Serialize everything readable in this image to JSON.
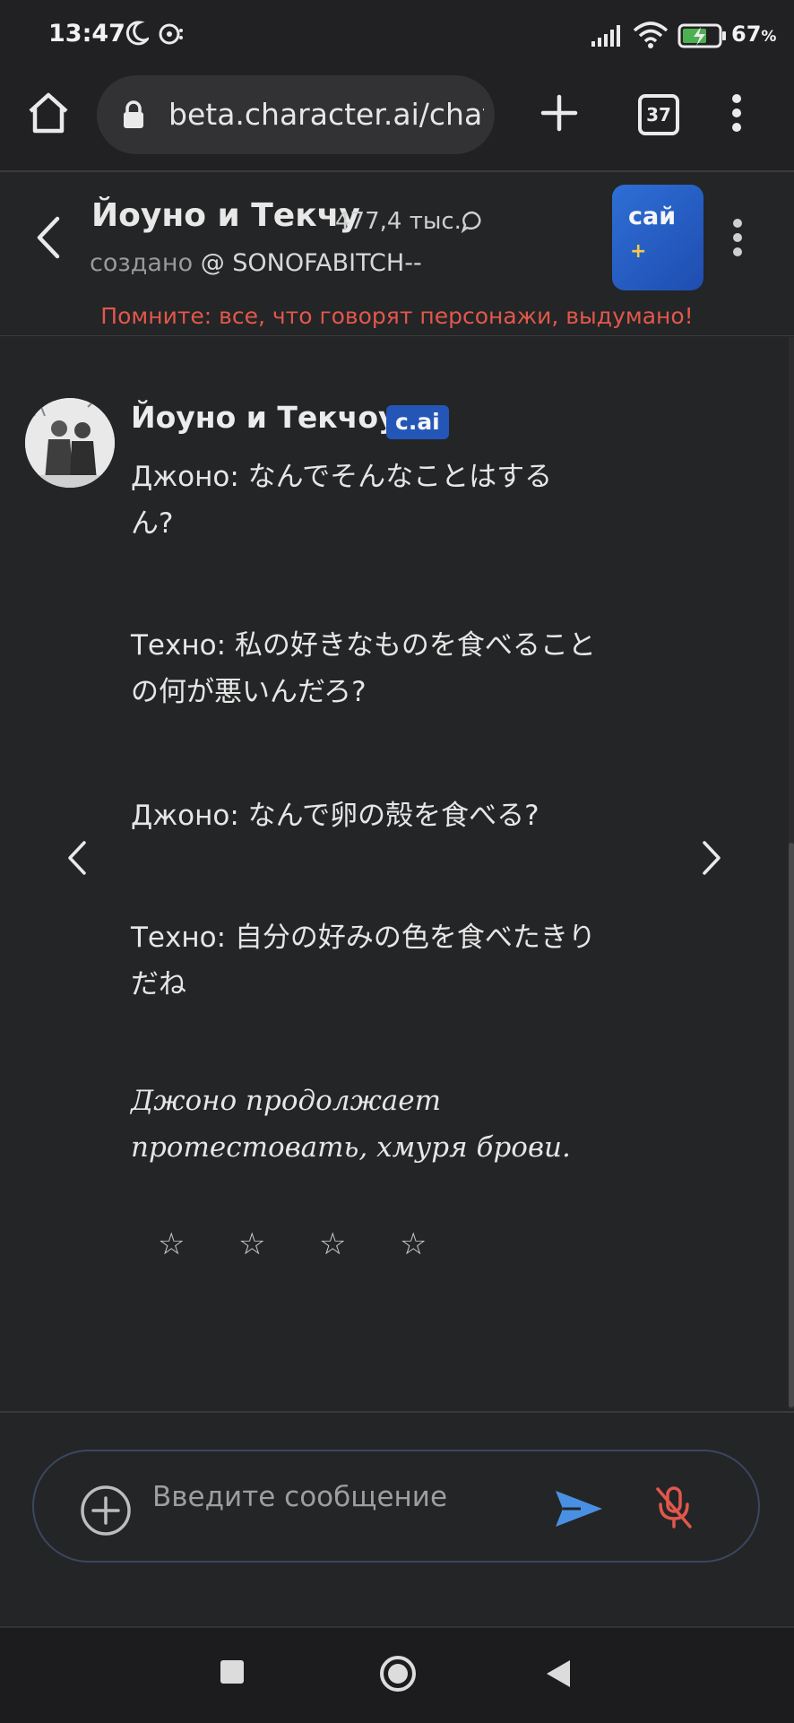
{
  "status_bar": {
    "time": "13:47",
    "battery_percent": "67",
    "battery_unit": "%"
  },
  "browser": {
    "url": "beta.character.ai/chat",
    "tab_count": "37"
  },
  "chat_header": {
    "character_name": "Йоуно и Текчу",
    "chat_count": "477,4 тыс.",
    "creator_prefix": "создано",
    "creator_handle": "@ SONOFABITCH--",
    "plus_label": "сай",
    "plus_mark": "+",
    "warning": "Помните: все, что говорят персонажи, выдумано!"
  },
  "message": {
    "author": "Йоуно и Текчоу",
    "badge": "c.ai",
    "lines": [
      "Джоно: なんでそんなことはする",
      "ん?",
      "Техно: 私の好きなものを食べること",
      "の何が悪いんだろ?",
      "Джоно: なんで卵の殻を食べる?",
      "Техно: 自分の好みの色を食べたきり",
      "だね",
      "Джоно продолжает",
      "протестовать, хмуря брови."
    ],
    "stars": [
      "☆",
      "☆",
      "☆",
      "☆"
    ],
    "rating": 0
  },
  "composer": {
    "placeholder": "Введите сообщение"
  },
  "icons": {
    "accent": "#2e6fd6",
    "warning_color": "#e2574c",
    "send_color": "#4a90e2",
    "mic_muted_color": "#e2574c"
  }
}
